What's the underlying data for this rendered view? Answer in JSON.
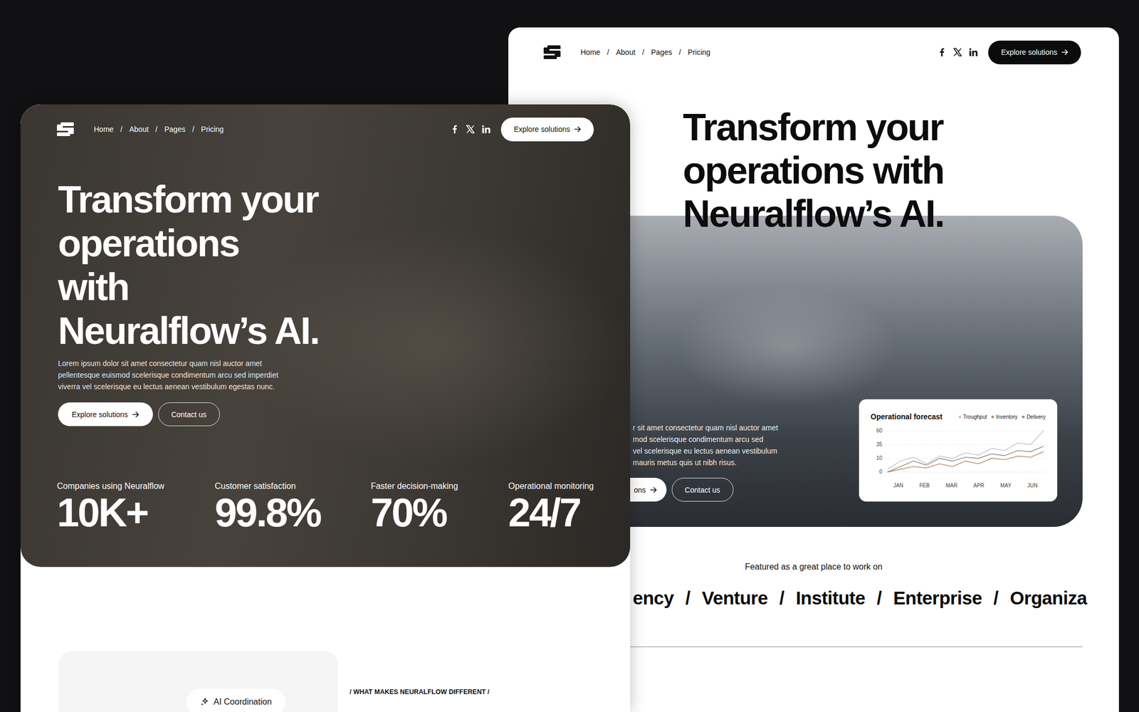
{
  "left_page": {
    "nav": {
      "links": [
        "Home",
        "About",
        "Pages",
        "Pricing"
      ],
      "separator": "/",
      "cta": "Explore solutions"
    },
    "hero": {
      "heading_lines": [
        "Transform your",
        "operations",
        "with",
        "Neuralflow’s AI."
      ],
      "paragraph": "Lorem ipsum dolor sit amet consectetur quam nisl auctor amet pellentesque euismod scelerisque condimentum arcu sed imperdiet viverra vel scelerisque eu lectus aenean vestibulum egestas nunc.",
      "primary_button": "Explore solutions",
      "secondary_button": "Contact us",
      "stats": [
        {
          "label": "Companies using Neuralflow",
          "value": "10K+"
        },
        {
          "label": "Customer satisfaction",
          "value": "99.8%"
        },
        {
          "label": "Faster decision-making",
          "value": "70%"
        },
        {
          "label": "Operational monitoring",
          "value": "24/7"
        }
      ]
    },
    "feature": {
      "pill": "AI Coordination",
      "eyebrow": "/ WHAT MAKES NEURALFLOW DIFFERENT /"
    }
  },
  "right_page": {
    "nav": {
      "links": [
        "Home",
        "About",
        "Pages",
        "Pricing"
      ],
      "separator": "/",
      "cta": "Explore solutions"
    },
    "hero": {
      "heading_lines": [
        "Transform your",
        "operations with",
        "Neuralflow’s AI."
      ],
      "paragraph_lines": [
        "r sit amet consectetur quam nisl auctor amet",
        "mod scelerisque condimentum arcu sed",
        "vel scelerisque eu lectus aenean vestibulum",
        "mauris metus quis ut nibh risus."
      ],
      "primary_button": "ons",
      "secondary_button": "Contact us"
    },
    "chart": {
      "title": "Operational forecast",
      "series": [
        {
          "label": "Troughput",
          "color": "#c4c4c4",
          "values": [
            2,
            8,
            12,
            6,
            14,
            10,
            20,
            16,
            28,
            24,
            38,
            35,
            60
          ]
        },
        {
          "label": "Inventory",
          "color": "#b58b68",
          "values": [
            0,
            2,
            4,
            3,
            6,
            4,
            8,
            6,
            10,
            9,
            14,
            12,
            22
          ]
        },
        {
          "label": "Delivery",
          "color": "#8c8c8c",
          "values": [
            0,
            4,
            8,
            5,
            10,
            8,
            12,
            10,
            18,
            15,
            24,
            22,
            32
          ]
        }
      ],
      "y_ticks": [
        "60",
        "35",
        "10",
        "0"
      ],
      "x_labels": [
        "JAN",
        "FEB",
        "MAR",
        "APR",
        "MAY",
        "JUN"
      ]
    },
    "featured": {
      "caption": "Featured as a great place to work on",
      "separator": "/",
      "logos": [
        "ency",
        "Venture",
        "Institute",
        "Enterprise",
        "Organiza"
      ]
    }
  }
}
